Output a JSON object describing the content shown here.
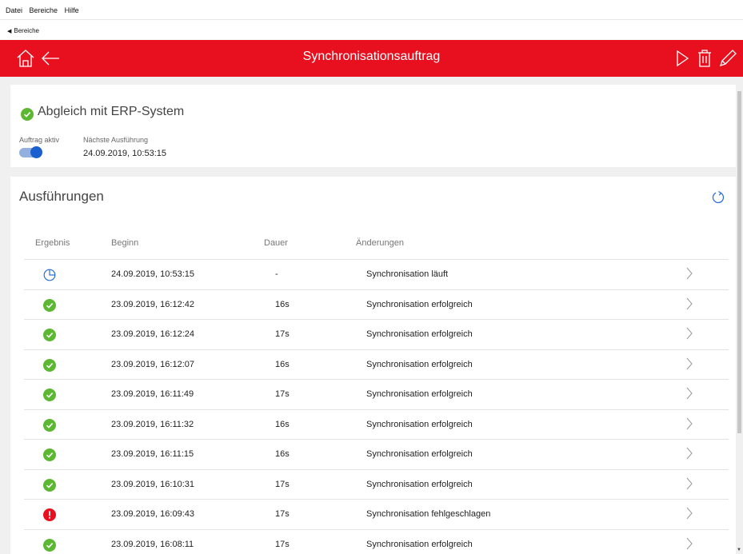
{
  "menu": {
    "items": [
      "Datei",
      "Bereiche",
      "Hilfe"
    ]
  },
  "nav": {
    "back_label": "Bereiche"
  },
  "header": {
    "title": "Synchronisationsauftrag",
    "color": "#e8101f"
  },
  "job": {
    "name": "Abgleich mit ERP-System",
    "active_label": "Auftrag aktiv",
    "active": true,
    "next_run_label": "Nächste Ausführung",
    "next_run": "24.09.2019, 10:53:15"
  },
  "executions": {
    "title": "Ausführungen",
    "columns": {
      "result": "Ergebnis",
      "start": "Beginn",
      "duration": "Dauer",
      "changes": "Änderungen"
    },
    "rows": [
      {
        "status": "running",
        "start": "24.09.2019, 10:53:15",
        "duration": "-",
        "changes": "Synchronisation läuft"
      },
      {
        "status": "success",
        "start": "23.09.2019, 16:12:42",
        "duration": "16s",
        "changes": "Synchronisation erfolgreich"
      },
      {
        "status": "success",
        "start": "23.09.2019, 16:12:24",
        "duration": "17s",
        "changes": "Synchronisation erfolgreich"
      },
      {
        "status": "success",
        "start": "23.09.2019, 16:12:07",
        "duration": "16s",
        "changes": "Synchronisation erfolgreich"
      },
      {
        "status": "success",
        "start": "23.09.2019, 16:11:49",
        "duration": "17s",
        "changes": "Synchronisation erfolgreich"
      },
      {
        "status": "success",
        "start": "23.09.2019, 16:11:32",
        "duration": "16s",
        "changes": "Synchronisation erfolgreich"
      },
      {
        "status": "success",
        "start": "23.09.2019, 16:11:15",
        "duration": "16s",
        "changes": "Synchronisation erfolgreich"
      },
      {
        "status": "success",
        "start": "23.09.2019, 16:10:31",
        "duration": "17s",
        "changes": "Synchronisation erfolgreich"
      },
      {
        "status": "error",
        "start": "23.09.2019, 16:09:43",
        "duration": "17s",
        "changes": "Synchronisation fehlgeschlagen"
      },
      {
        "status": "success",
        "start": "23.09.2019, 16:08:11",
        "duration": "17s",
        "changes": "Synchronisation erfolgreich"
      }
    ]
  },
  "colors": {
    "success": "#5cb832",
    "error": "#e8101f",
    "running": "#2a6fd6",
    "accent": "#1a5fd0"
  },
  "icons": [
    "home-icon",
    "back-arrow-icon",
    "play-icon",
    "trash-icon",
    "edit-icon",
    "refresh-icon",
    "check-circle-icon",
    "error-circle-icon",
    "clock-icon",
    "chevron-right-icon"
  ]
}
